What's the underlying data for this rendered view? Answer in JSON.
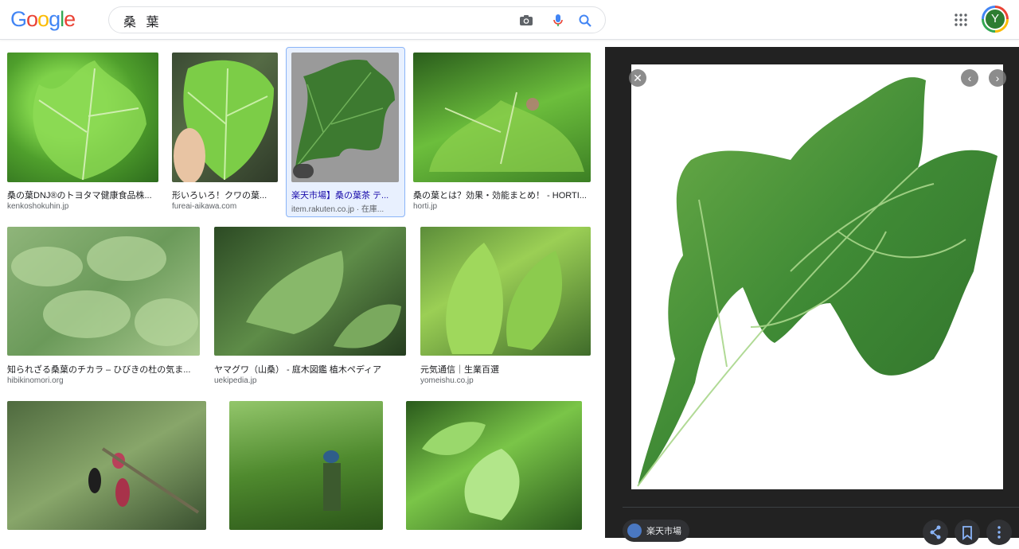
{
  "logo": {
    "letters": [
      "G",
      "o",
      "o",
      "g",
      "l",
      "e"
    ],
    "colors": [
      "#4285f4",
      "#ea4335",
      "#fbbc05",
      "#4285f4",
      "#34a853",
      "#ea4335"
    ]
  },
  "search": {
    "query": "桑 葉",
    "icons": [
      "camera-icon",
      "mic-icon",
      "search-icon"
    ]
  },
  "header": {
    "apps_icon": "apps-grid-icon",
    "avatar_letter": "Y"
  },
  "results": [
    {
      "title": "桑の葉DNJ®のトヨタマ健康食品株...",
      "source": "kenkoshokuhin.jp"
    },
    {
      "title": "形いろいろ！クワの葉...",
      "source": "fureai-aikawa.com"
    },
    {
      "title": "楽天市場】桑の葉茶 テ...",
      "source": "item.rakuten.co.jp · 在庫..."
    },
    {
      "title": "桑の葉とは？効果・効能まとめ！ - HORTI...",
      "source": "horti.jp"
    },
    {
      "title": "知られざる桑葉のチカラ – ひびきの杜の気ま...",
      "source": "hibikinomori.org"
    },
    {
      "title": "ヤマグワ（山桑） - 庭木図鑑 植木ペディア",
      "source": "uekipedia.jp"
    },
    {
      "title": "元気通信｜生業百選",
      "source": "yomeishu.co.jp"
    },
    {
      "title": "",
      "source": ""
    },
    {
      "title": "",
      "source": ""
    },
    {
      "title": "",
      "source": ""
    }
  ],
  "panel": {
    "close_icon": "close-icon",
    "prev_icon": "chevron-left-icon",
    "next_icon": "chevron-right-icon",
    "source_name": "楽天市場",
    "actions": [
      "share-icon",
      "bookmark-icon",
      "more-vert-icon"
    ]
  }
}
